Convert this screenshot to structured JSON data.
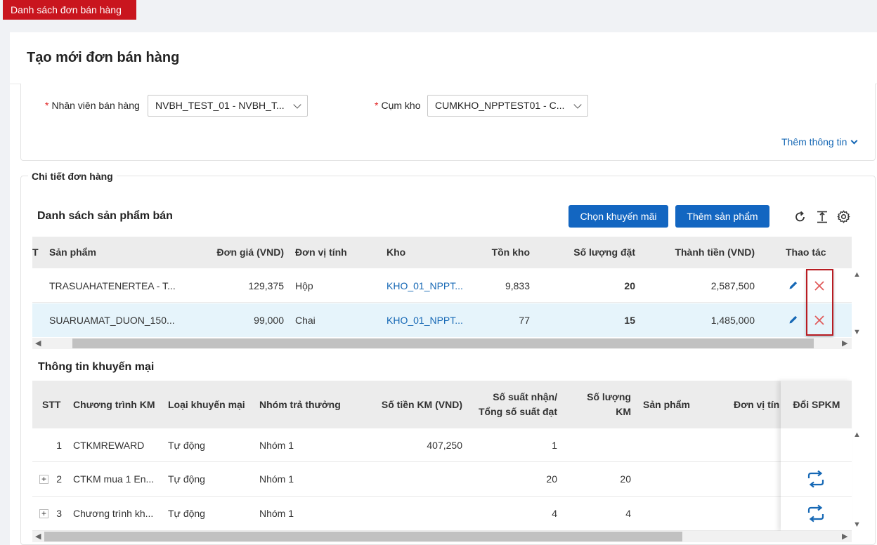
{
  "top_tab": {
    "label": "Danh sách đơn bán hàng"
  },
  "page": {
    "title": "Tạo mới đơn bán hàng"
  },
  "form": {
    "salesperson": {
      "label": "Nhân viên bán hàng",
      "value": "NVBH_TEST_01 - NVBH_T..."
    },
    "warehouse_cluster": {
      "label": "Cụm kho",
      "value": "CUMKHO_NPPTEST01 - C..."
    },
    "more_info": "Thêm thông tin"
  },
  "details": {
    "legend": "Chi tiết đơn hàng",
    "products": {
      "title": "Danh sách sản phẩm bán",
      "btn_promo": "Chọn khuyến mãi",
      "btn_add": "Thêm sản phẩm",
      "columns": {
        "stt": "T",
        "product": "Sản phẩm",
        "price": "Đơn giá (VND)",
        "unit": "Đơn vị tính",
        "warehouse": "Kho",
        "stock": "Tồn kho",
        "qty": "Số lượng đặt",
        "amount": "Thành tiền (VND)",
        "actions": "Thao tác"
      },
      "rows": [
        {
          "product": "TRASUAHATENERTEA - T...",
          "price": "129,375",
          "unit": "Hộp",
          "warehouse": "KHO_01_NPPT...",
          "stock": "9,833",
          "qty": "20",
          "amount": "2,587,500"
        },
        {
          "product": "SUARUAMAT_DUON_150...",
          "price": "99,000",
          "unit": "Chai",
          "warehouse": "KHO_01_NPPT...",
          "stock": "77",
          "qty": "15",
          "amount": "1,485,000"
        }
      ]
    },
    "promotions": {
      "title": "Thông tin khuyến mại",
      "columns": {
        "stt": "STT",
        "program": "Chương trình KM",
        "type": "Loại khuyến mại",
        "group": "Nhóm trả thưởng",
        "amount": "Số tiền KM (VND)",
        "slots_line1": "Số suất nhận/",
        "slots_line2": "Tổng số suất đạt",
        "qty_line1": "Số lượng",
        "qty_line2": "KM",
        "product": "Sản phẩm",
        "unit": "Đơn vị tín",
        "swap": "Đổi SPKM"
      },
      "rows": [
        {
          "stt": "1",
          "program": "CTKMREWARD",
          "type": "Tự động",
          "group": "Nhóm 1",
          "amount": "407,250",
          "slots": "1",
          "qty": "",
          "expand": ""
        },
        {
          "stt": "2",
          "program": "CTKM mua 1 En...",
          "type": "Tự động",
          "group": "Nhóm 1",
          "amount": "",
          "slots": "20",
          "qty": "20",
          "expand": "+"
        },
        {
          "stt": "3",
          "program": "Chương trình kh...",
          "type": "Tự động",
          "group": "Nhóm 1",
          "amount": "",
          "slots": "4",
          "qty": "4",
          "expand": "+"
        }
      ]
    }
  }
}
